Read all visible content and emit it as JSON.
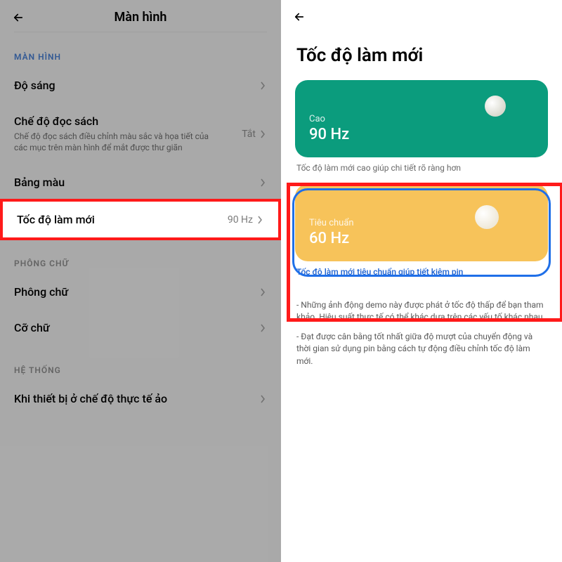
{
  "left": {
    "header_title": "Màn hình",
    "section_display": "MÀN HÌNH",
    "brightness": "Độ sáng",
    "reading_mode_title": "Chế độ đọc sách",
    "reading_mode_sub": "Chế độ đọc sách điều chỉnh màu sắc và họa tiết của các mục trên màn hình để mắt được thư giãn",
    "reading_mode_value": "Tắt",
    "color_palette": "Bảng màu",
    "refresh_rate": "Tốc độ làm mới",
    "refresh_rate_value": "90 Hz",
    "section_font": "PHÔNG CHỮ",
    "font": "Phông chữ",
    "font_size": "Cỡ chữ",
    "section_system": "HỆ THỐNG",
    "vr_mode": "Khi thiết bị ở chế độ thực tế ảo"
  },
  "right": {
    "title": "Tốc độ làm mới",
    "high_label": "Cao",
    "high_hz": "90 Hz",
    "high_caption": "Tốc độ làm mới cao giúp chi tiết rõ ràng hơn",
    "std_label": "Tiêu chuẩn",
    "std_hz": "60 Hz",
    "std_caption": "Tốc độ làm mới tiêu chuẩn giúp tiết kiệm pin",
    "note1": "- Những ảnh động demo này được phát ở tốc độ thấp để bạn tham khảo. Hiệu suất thực tế có thể khác dựa trên các yếu tố khác nhau.",
    "note2": "- Đạt được cân bằng tốt nhất giữa độ mượt của chuyển động và thời gian sử dụng pin bằng cách tự động điều chỉnh tốc độ làm mới."
  }
}
